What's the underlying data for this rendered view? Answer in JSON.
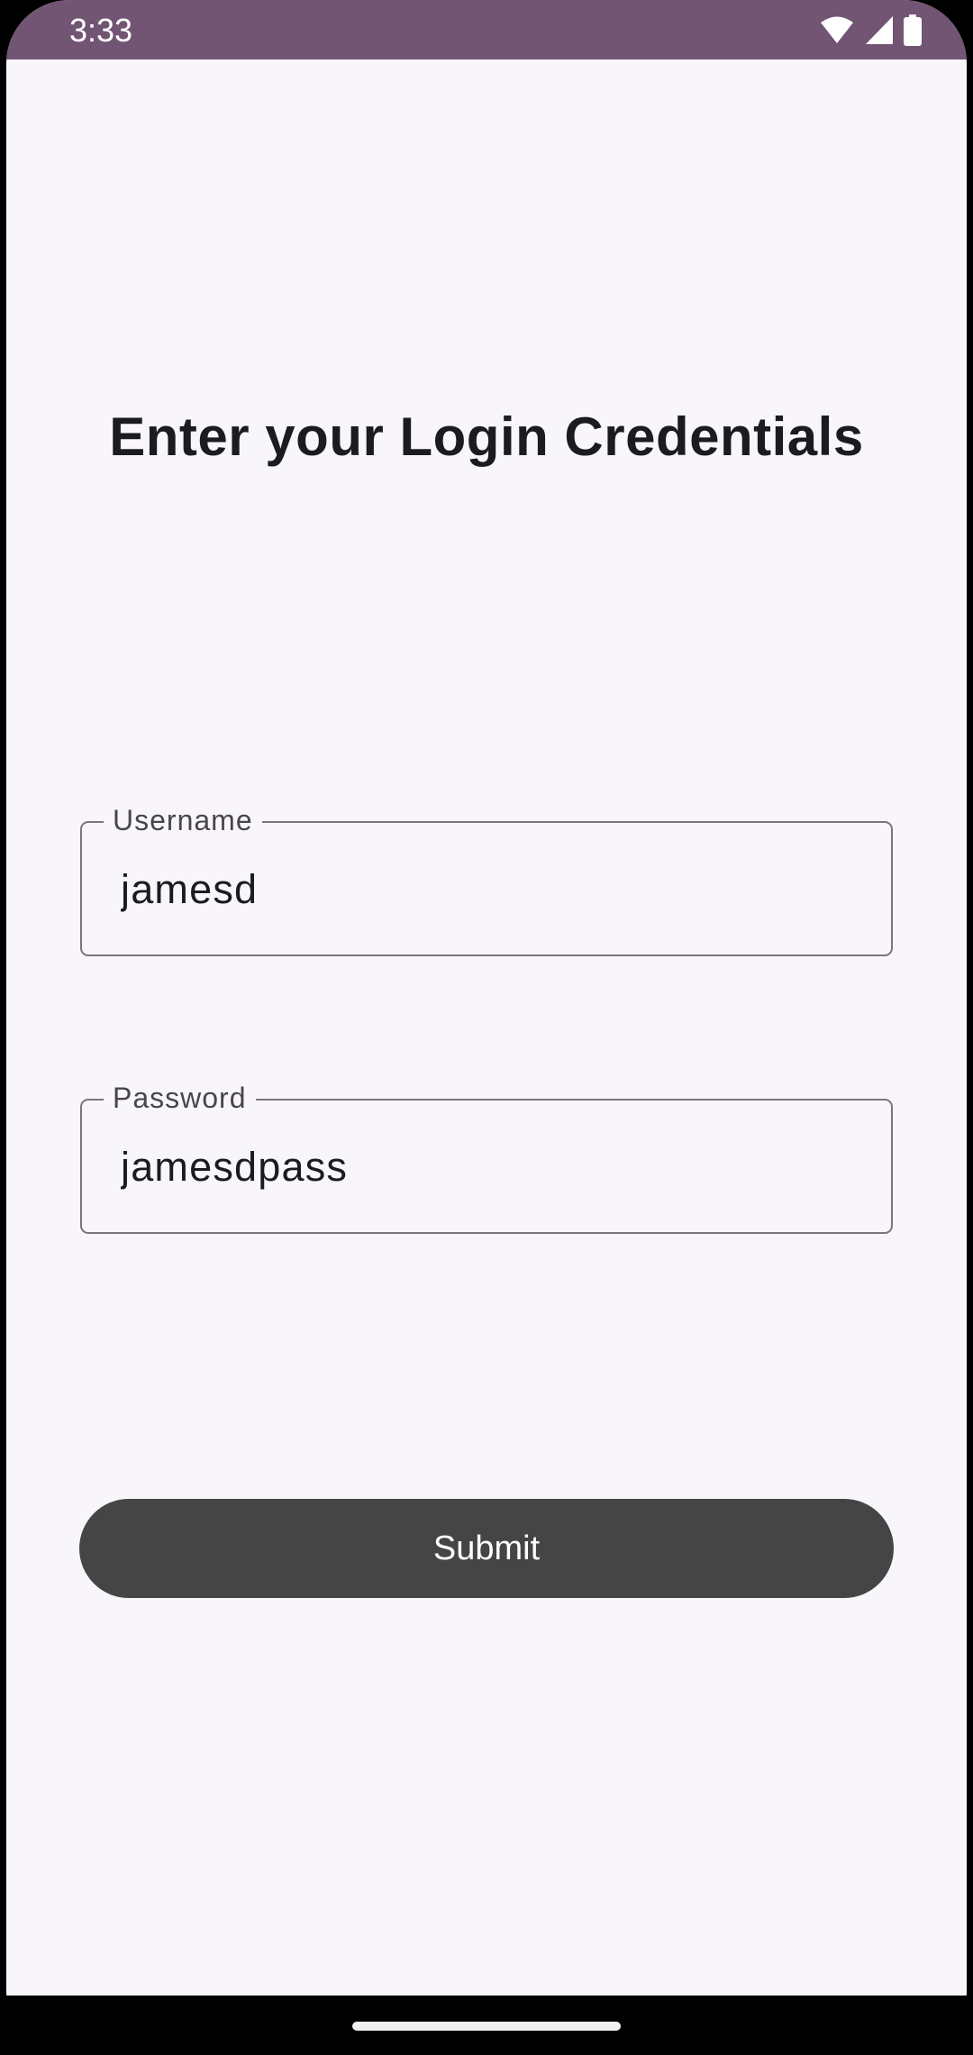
{
  "status_bar": {
    "time": "3:33",
    "icons": [
      "wifi-icon",
      "cellular-signal-icon",
      "battery-icon"
    ],
    "background_color": "#725473"
  },
  "login": {
    "title": "Enter your Login Credentials",
    "username": {
      "label": "Username",
      "value": "jamesd"
    },
    "password": {
      "label": "Password",
      "value": "jamesdpass"
    },
    "submit_label": "Submit"
  },
  "colors": {
    "background": "#f8f6fb",
    "button": "#454545",
    "field_border": "#79747e",
    "text": "#1c1b1f"
  }
}
